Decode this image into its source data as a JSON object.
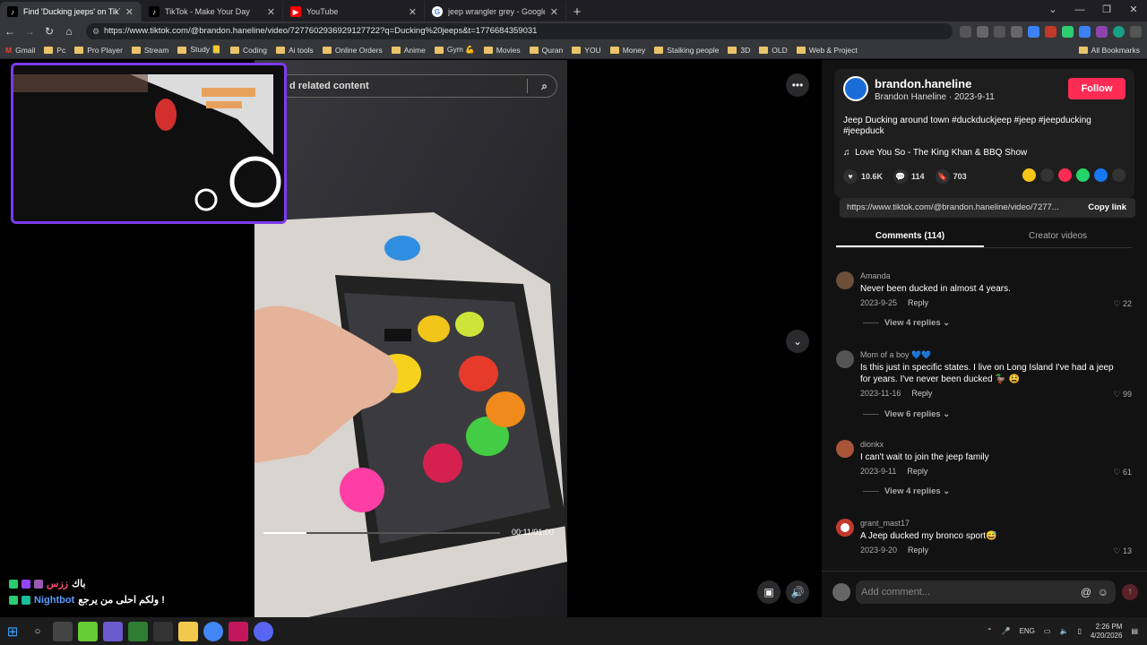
{
  "tabs": [
    {
      "title": "Find 'Ducking jeeps' on TikTok",
      "favicon": "tiktok-icon",
      "active": true
    },
    {
      "title": "TikTok - Make Your Day",
      "favicon": "tiktok-icon",
      "active": false
    },
    {
      "title": "YouTube",
      "favicon": "youtube-icon",
      "active": false
    },
    {
      "title": "jeep wrangler grey - Google Se",
      "favicon": "google-icon",
      "active": false
    }
  ],
  "address": {
    "url": "https://www.tiktok.com/@brandon.haneline/video/7277602936929127722?q=Ducking%20jeeps&t=1776684359031"
  },
  "bookmarks": [
    "Gmail",
    "Pc",
    "Pro Player",
    "Stream",
    "Study 📒",
    "Coding",
    "Ai tools",
    "Online Orders",
    "Anime",
    "Gym 💪",
    "Movies",
    "Quran",
    "YOU",
    "Money",
    "Stalking people",
    "3D",
    "OLD",
    "Web & Project"
  ],
  "all_bookmarks": "All Bookmarks",
  "video": {
    "search_placeholder": "d related content",
    "time": "00:11/01:00",
    "progress": 0.18
  },
  "author": {
    "handle": "brandon.haneline",
    "subline": "Brandon Haneline · 2023-9-11",
    "follow_label": "Follow",
    "description": "Jeep Ducking around town #duckduckjeep #jeep #jeepducking #jeepduck",
    "music": "Love You So - The King Khan & BBQ Show"
  },
  "stats": {
    "likes": "10.6K",
    "comments": "114",
    "saves": "703"
  },
  "link": {
    "url": "https://www.tiktok.com/@brandon.haneline/video/7277...",
    "copy_label": "Copy link"
  },
  "comment_tabs": [
    "Comments (114)",
    "Creator videos"
  ],
  "comments": [
    {
      "user": "Amanda",
      "text": "Never been ducked in almost 4 years.",
      "date": "2023-9-25",
      "likes": "22",
      "replies": "View 4 replies"
    },
    {
      "user": "Mom of a boy 💙💙",
      "text": "Is this just in specific states. I live on Long Island I've had a jeep for years. I've never been ducked 🦆 😫",
      "date": "2023-11-16",
      "likes": "99",
      "replies": "View 6 replies"
    },
    {
      "user": "dionkx",
      "text": "I can't wait to join the jeep family",
      "date": "2023-9-11",
      "likes": "61",
      "replies": "View 4 replies"
    },
    {
      "user": "grant_mast17",
      "text": "A Jeep ducked my bronco sport😅",
      "date": "2023-9-20",
      "likes": "13",
      "replies": ""
    }
  ],
  "reply_label": "Reply",
  "add_comment_placeholder": "Add comment...",
  "chat": [
    {
      "name": "ززس",
      "message": "باك"
    },
    {
      "name": "Nightbot",
      "message": "ولكم احلى من يرجع !"
    }
  ],
  "taskbar": {
    "lang": "ENG",
    "time": "2:26 PM",
    "date": "4/20/2026"
  },
  "colors": {
    "follow": "#fe2c55",
    "cam_border": "#7c3aed",
    "bookmark_folder": "#e9c46a"
  }
}
